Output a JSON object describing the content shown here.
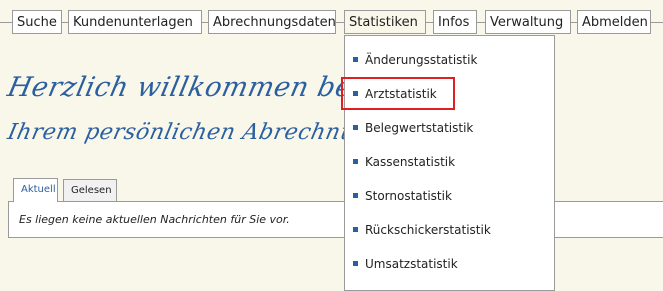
{
  "nav": {
    "items": [
      {
        "label": "Suche"
      },
      {
        "label": "Kundenunterlagen"
      },
      {
        "label": "Abrechnungsdaten"
      },
      {
        "label": "Statistiken"
      },
      {
        "label": "Infos"
      },
      {
        "label": "Verwaltung"
      },
      {
        "label": "Abmelden"
      }
    ]
  },
  "welcome": {
    "line1": "Herzlich willkommen bei der DZR",
    "line2": "Ihrem persönlichen Abrechnungshaus"
  },
  "tabs": [
    {
      "label": "Aktuell"
    },
    {
      "label": "Gelesen"
    }
  ],
  "news": {
    "message": "Es liegen keine aktuellen Nachrichten für Sie vor."
  },
  "statistiken_menu": {
    "items": [
      {
        "label": "Änderungsstatistik"
      },
      {
        "label": "Arztstatistik"
      },
      {
        "label": "Belegwertstatistik"
      },
      {
        "label": "Kassenstatistik"
      },
      {
        "label": "Stornostatistik"
      },
      {
        "label": "Rückschickerstatistik"
      },
      {
        "label": "Umsatzstatistik"
      }
    ],
    "highlighted": "Arztstatistik"
  },
  "colors": {
    "accent": "#2b5fa0",
    "background": "#f8f7ea",
    "highlight_border": "#e02020"
  }
}
